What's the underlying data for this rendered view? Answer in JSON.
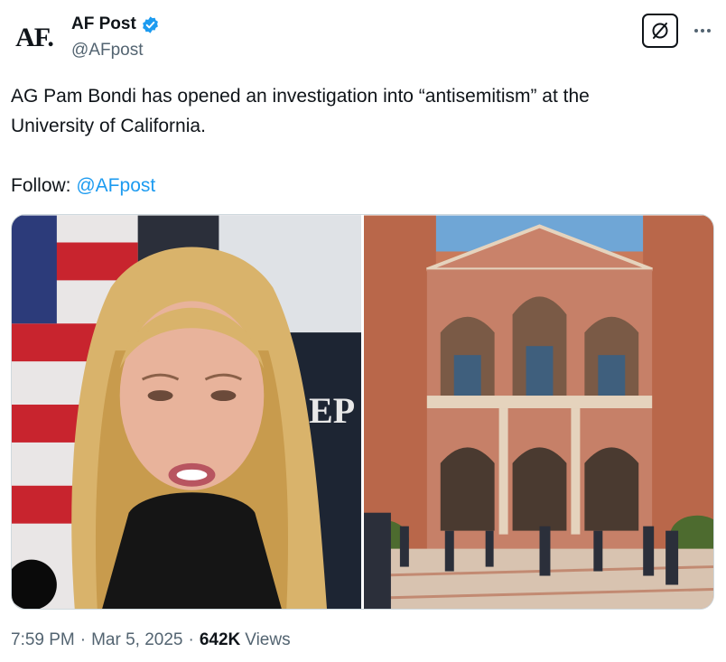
{
  "author": {
    "display_name": "AF Post",
    "handle": "@AFpost",
    "avatar_text": "AF.",
    "verified": true
  },
  "tweet": {
    "text_line1": "AG Pam Bondi has opened an investigation into “antisemitism” at the",
    "text_line2": "University of California.",
    "follow_label": "Follow: ",
    "follow_mention": "@AFpost"
  },
  "media": {
    "left_image": "portrait-photo",
    "right_image": "campus-building-photo"
  },
  "meta": {
    "time": "7:59 PM",
    "separator": "·",
    "date": "Mar 5, 2025",
    "views_count": "642K",
    "views_label": "Views"
  },
  "colors": {
    "accent": "#1d9bf0",
    "text": "#0f1419",
    "secondary": "#536471"
  }
}
